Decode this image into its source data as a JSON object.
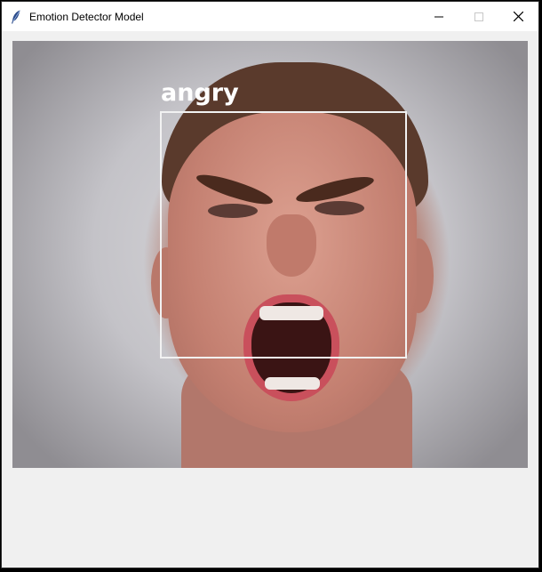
{
  "window": {
    "title": "Emotion Detector Model",
    "app_icon": "feather-icon",
    "controls": [
      "minimize-icon",
      "maximize-icon",
      "close-icon"
    ]
  },
  "detection": {
    "label": "angry",
    "box_color": "#f2f2f2",
    "label_color": "#ffffff"
  }
}
